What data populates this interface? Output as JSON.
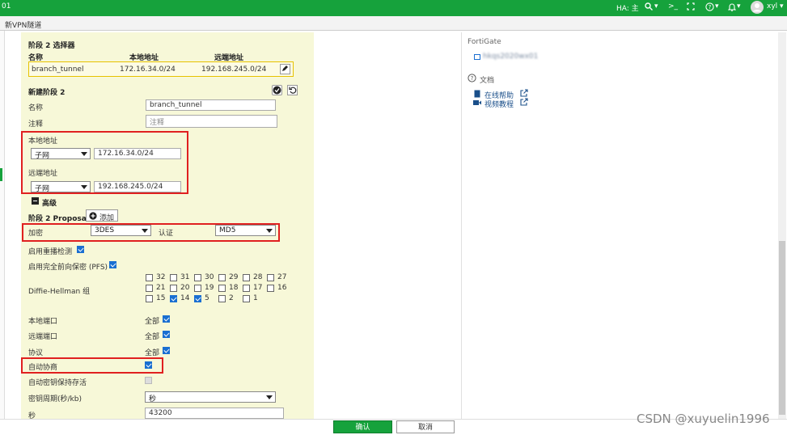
{
  "topbar": {
    "left_text": "01",
    "ha": "HA: 主",
    "search_caret": "▾",
    "terminal": ">_",
    "help_caret": "▾",
    "bell_caret": "▾",
    "user": "xyl",
    "user_caret": "▾"
  },
  "window_title": "新VPN隧道",
  "selector_section": {
    "title": "阶段 2 选择器",
    "col_name": "名称",
    "col_local": "本地地址",
    "col_remote": "远端地址",
    "row": {
      "name": "branch_tunnel",
      "local": "172.16.34.0/24",
      "remote": "192.168.245.0/24"
    }
  },
  "new_phase2": {
    "title": "新建阶段 2",
    "name_label": "名称",
    "name_value": "branch_tunnel",
    "comment_label": "注释",
    "comment_placeholder": "注释",
    "local_label": "本地地址",
    "local_type": "子网",
    "local_value": "172.16.34.0/24",
    "remote_label": "远端地址",
    "remote_type": "子网",
    "remote_value": "192.168.245.0/24",
    "advanced_label": "高级"
  },
  "proposal": {
    "title": "阶段 2 Proposal",
    "add_label": "添加",
    "encrypt_label": "加密",
    "encrypt_value": "3DES",
    "auth_label": "认证",
    "auth_value": "MD5"
  },
  "options": {
    "replay_label": "启用重播检测",
    "pfs_label": "启用完全前向保密 (PFS)",
    "dh_label": "Diffie-Hellman 组",
    "dh_groups": [
      {
        "v": "32",
        "on": false
      },
      {
        "v": "31",
        "on": false
      },
      {
        "v": "30",
        "on": false
      },
      {
        "v": "29",
        "on": false
      },
      {
        "v": "28",
        "on": false
      },
      {
        "v": "27",
        "on": false
      },
      {
        "v": "21",
        "on": false
      },
      {
        "v": "20",
        "on": false
      },
      {
        "v": "19",
        "on": false
      },
      {
        "v": "18",
        "on": false
      },
      {
        "v": "17",
        "on": false
      },
      {
        "v": "16",
        "on": false
      },
      {
        "v": "15",
        "on": false
      },
      {
        "v": "14",
        "on": true
      },
      {
        "v": "5",
        "on": true
      },
      {
        "v": "2",
        "on": false
      },
      {
        "v": "1",
        "on": false
      }
    ],
    "local_port_label": "本地端口",
    "remote_port_label": "远端端口",
    "protocol_label": "协议",
    "all_label": "全部",
    "auto_negotiate_label": "自动协商",
    "keepalive_label": "自动密钥保持存活",
    "key_lifetime_label": "密钥周期(秒/kb)",
    "key_lifetime_value": "秒",
    "seconds_label": "秒",
    "seconds_value": "43200"
  },
  "sidebar": {
    "title": "FortiGate",
    "device_name": "hkqs2020wx01",
    "docs_label": "文档",
    "online_help": "在线帮助",
    "video_tutorial": "视频教程"
  },
  "footer": {
    "ok": "确认",
    "cancel": "取消"
  },
  "watermark": "CSDN @xuyuelin1996",
  "colors": {
    "topbar": "#16a23c",
    "form_bg": "#f7f8d8",
    "highlight": "#e02020",
    "checkbox": "#1a6fd1"
  }
}
